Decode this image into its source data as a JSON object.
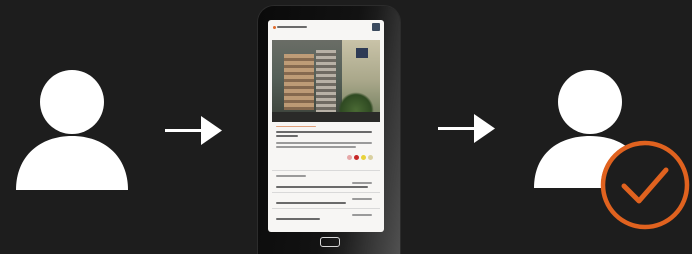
{
  "colors": {
    "background": "#1d1d1d",
    "person": "#ffffff",
    "arrow": "#ffffff",
    "badge": "#e0621f"
  },
  "icons": {
    "left": "person-icon",
    "arrow1": "arrow-right-icon",
    "device": "smartphone-icon",
    "arrow2": "arrow-right-icon",
    "right": "person-icon",
    "badge": "checkmark-circle-icon"
  }
}
